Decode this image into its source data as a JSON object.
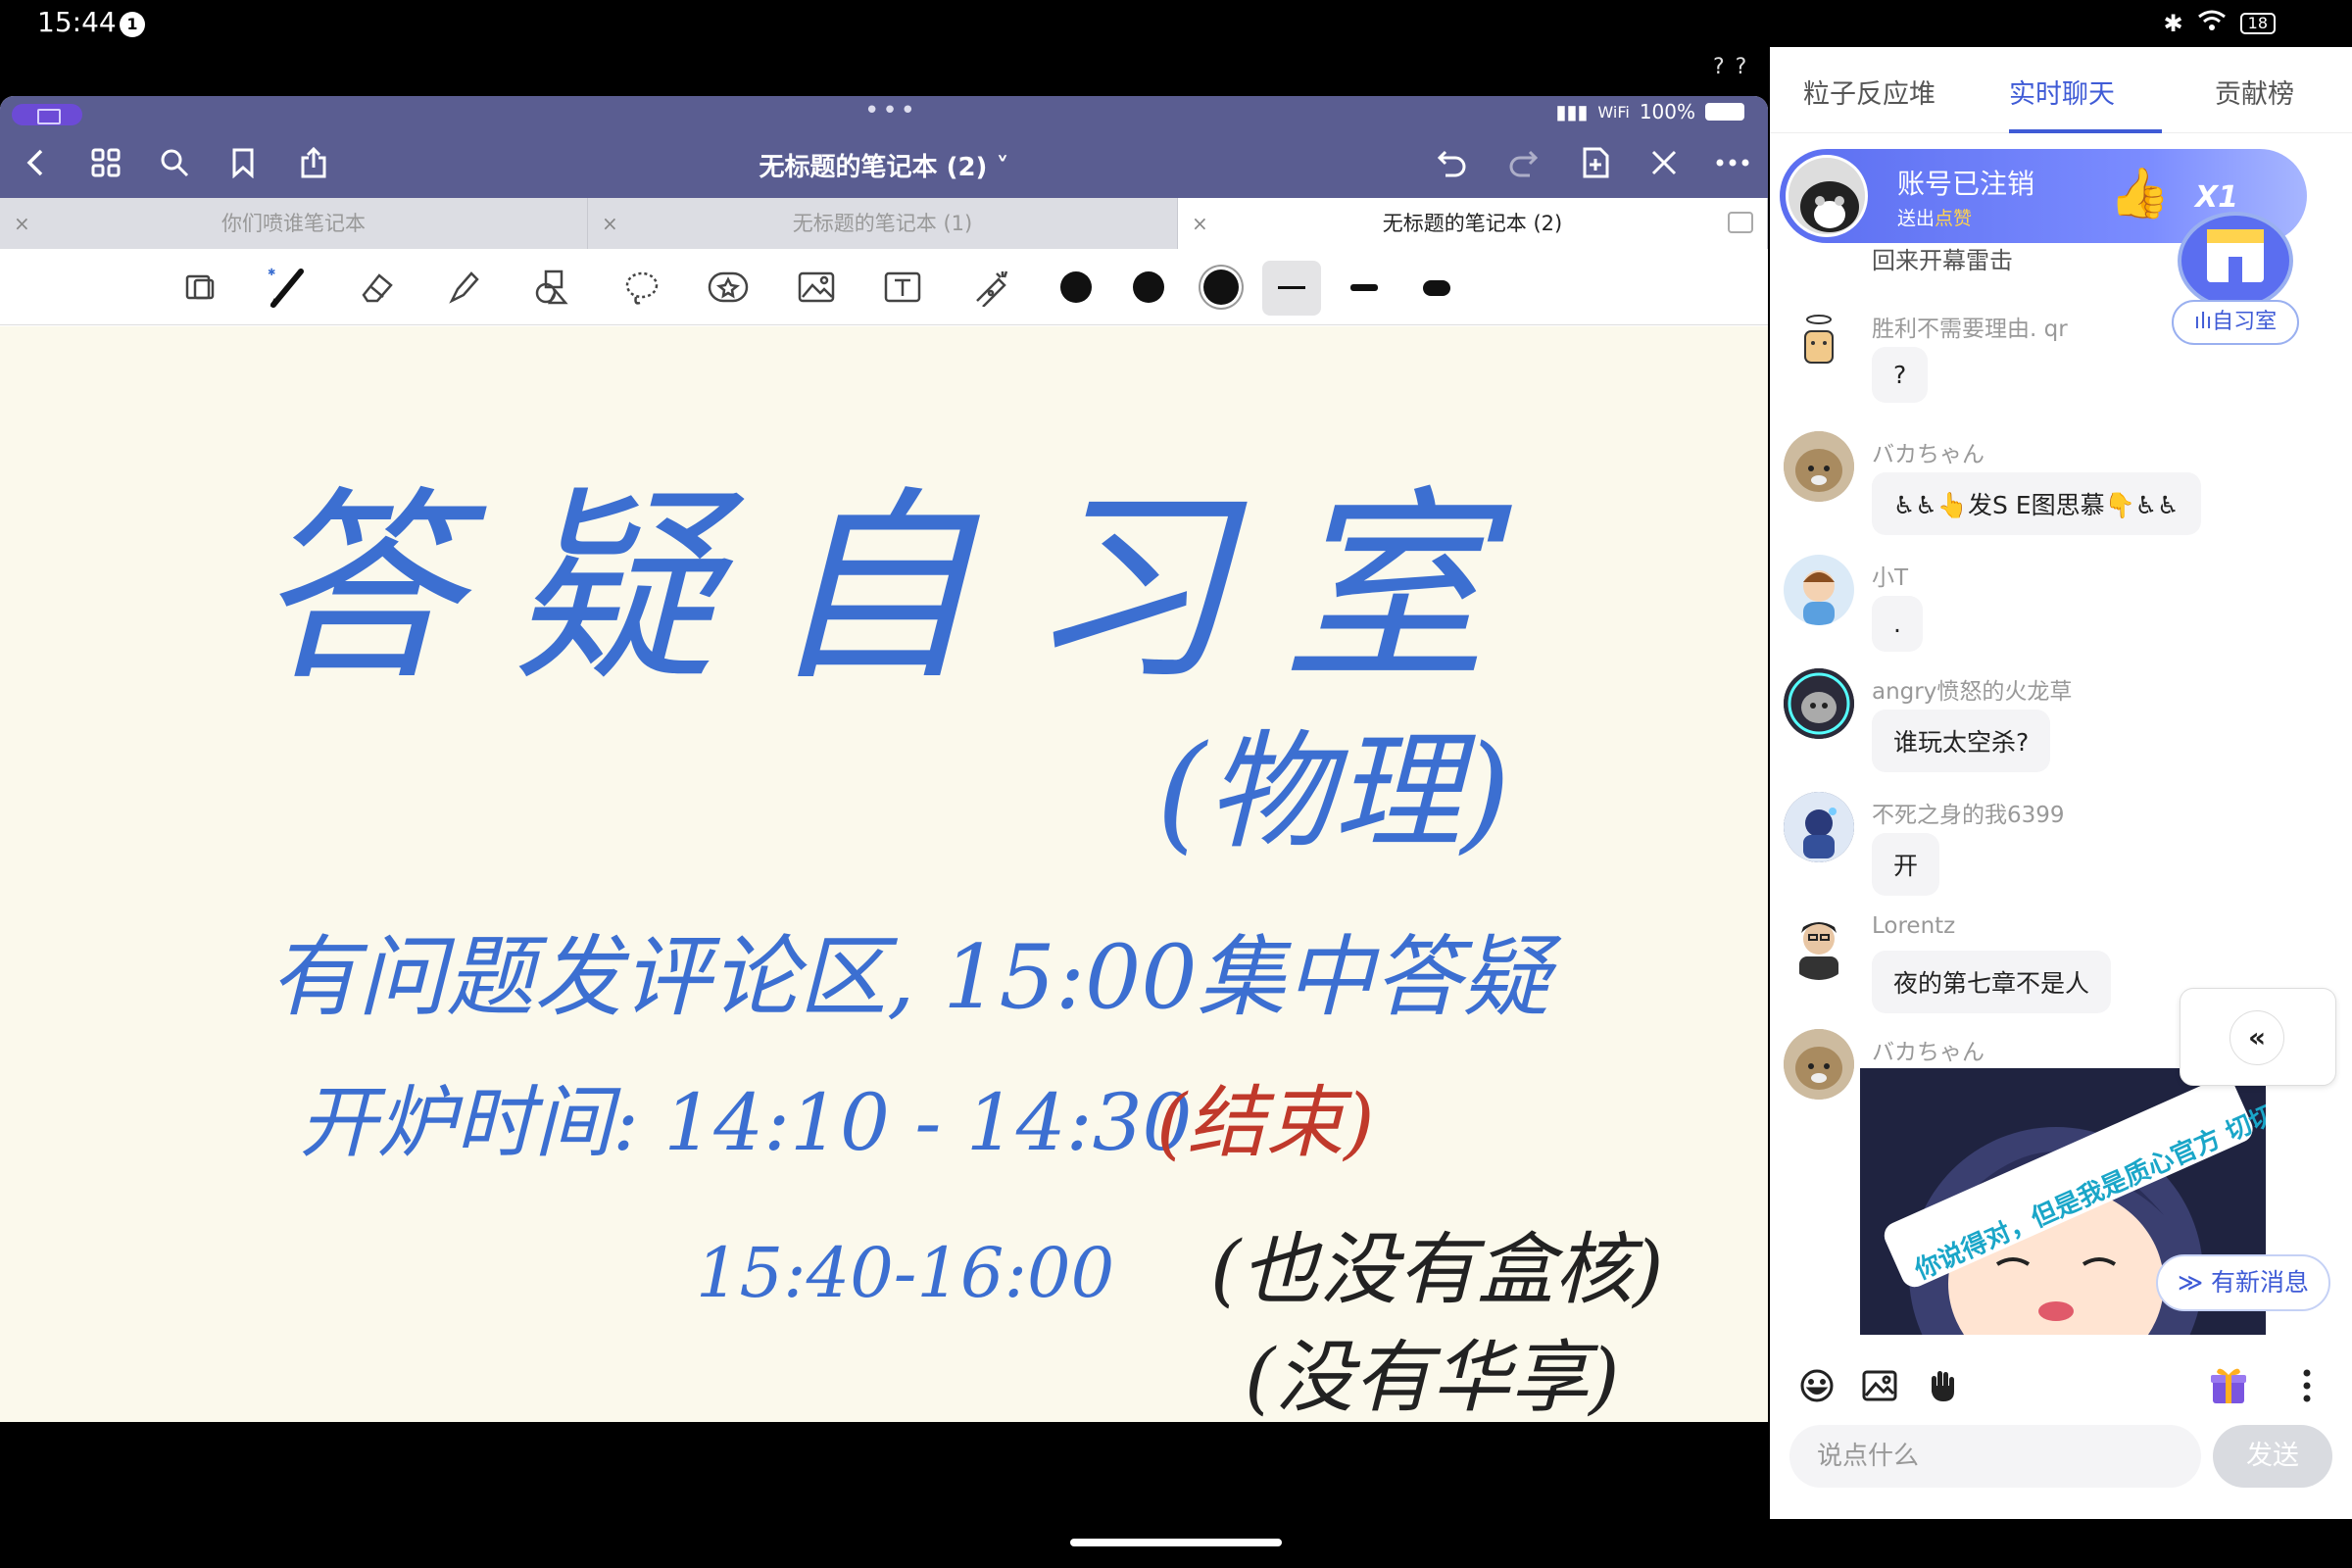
{
  "status_bar": {
    "time": "15:44",
    "notif_count": "1",
    "battery": "18"
  },
  "split_indicator": "? ?",
  "notes_app": {
    "ios_status": {
      "signal": "▮▮▮",
      "wifi": "WiFi",
      "battery": "100%"
    },
    "title": "无标题的笔记本 (2) ˅",
    "tabs": [
      {
        "label": "你们喷谁笔记本"
      },
      {
        "label": "无标题的笔记本 (1)"
      },
      {
        "label": "无标题的笔记本 (2)"
      }
    ],
    "handwriting": {
      "title": "答疑自习室",
      "subtitle": "(物理)",
      "line1": "有问题发评论区, 15:00集中答疑",
      "line2_prefix": "开炉时间: 14:10 - 14:30",
      "line2_red": "(结束)",
      "line3": "15:40-16:00",
      "line3_note": "(也没有盒核)",
      "line4_note": "(没有华享)"
    },
    "colors": {
      "header": "#5a5d91",
      "ink_blue": "#3c6fd1",
      "ink_red": "#c0392b",
      "paper": "#fbf9ec"
    }
  },
  "chat_panel": {
    "tabs": [
      {
        "label": "粒子反应堆"
      },
      {
        "label": "实时聊天"
      },
      {
        "label": "贡献榜"
      }
    ],
    "banner": {
      "name": "账号已注销",
      "sub_prefix": "送出",
      "sub_gift": "点赞",
      "multiplier": "X1",
      "hidden_text": "回来开幕雷击"
    },
    "room_badge": "ılı自习室",
    "messages": [
      {
        "user": "胜利不需要理由. qr",
        "text": "?"
      },
      {
        "user": "バカちゃん",
        "text": "♿♿👆发S E图思慕👇♿♿"
      },
      {
        "user": "小T",
        "text": "."
      },
      {
        "user": "angry愤怒的火龙草",
        "text": "谁玩太空杀?"
      },
      {
        "user": "不死之身的我6399",
        "text": "开"
      },
      {
        "user": "Lorentz",
        "text": "夜的第七章不是人"
      },
      {
        "user": "バカちゃん",
        "text": ""
      }
    ],
    "sticker_text": "你说得对，但是我是质心官方 切切要送你小黑屋了。",
    "collapse_icon": "«",
    "new_messages": "≫ 有新消息",
    "input_placeholder": "说点什么",
    "send_label": "发送"
  }
}
